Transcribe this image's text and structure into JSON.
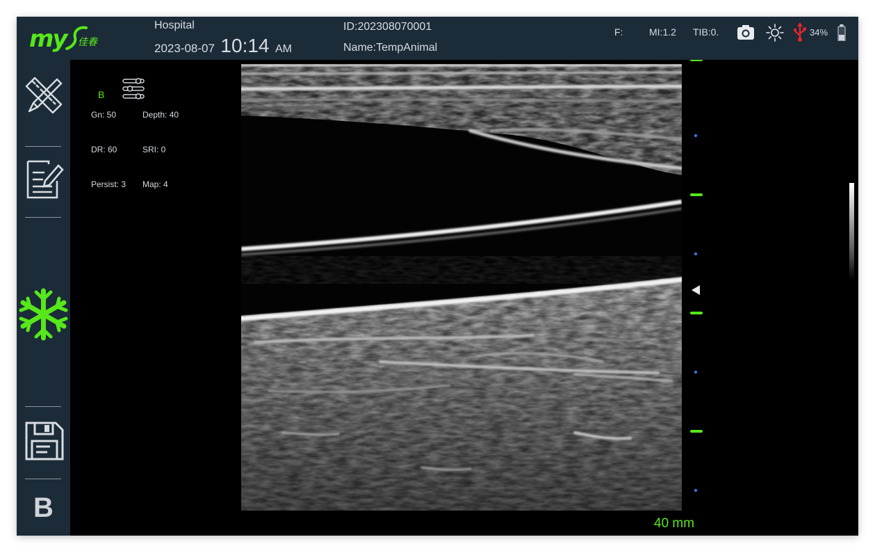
{
  "header": {
    "hospital": "Hospital",
    "date": "2023-08-07",
    "time": "10:14",
    "ampm": "AM",
    "patient_id": "ID:202308070001",
    "patient_name": "Name:TempAnimal",
    "f_label": "F:",
    "mi": "MI:1.2",
    "tib": "TIB:0.",
    "battery": "34%"
  },
  "logo": {
    "brand": "my",
    "chinese": "佳春"
  },
  "sidebar": {
    "items": [
      {
        "id": "measure",
        "icon": "ruler-pencil-icon"
      },
      {
        "id": "report",
        "icon": "edit-report-icon"
      },
      {
        "id": "freeze",
        "icon": "snowflake-icon"
      },
      {
        "id": "save",
        "icon": "save-icon"
      }
    ],
    "mode_label": "B"
  },
  "params": {
    "mode": "B",
    "gn": "Gn: 50",
    "depth": "Depth: 40",
    "dr": "DR: 60",
    "sri": "SRI: 0",
    "persist": "Persist: 3",
    "map": "Map: 4"
  },
  "scale": {
    "depth_label": "40 mm"
  },
  "colors": {
    "accent_green": "#56e81a",
    "panel_bg": "#1c2b38",
    "usb_red": "#e5262b",
    "scale_blue": "#3b6fe0"
  }
}
